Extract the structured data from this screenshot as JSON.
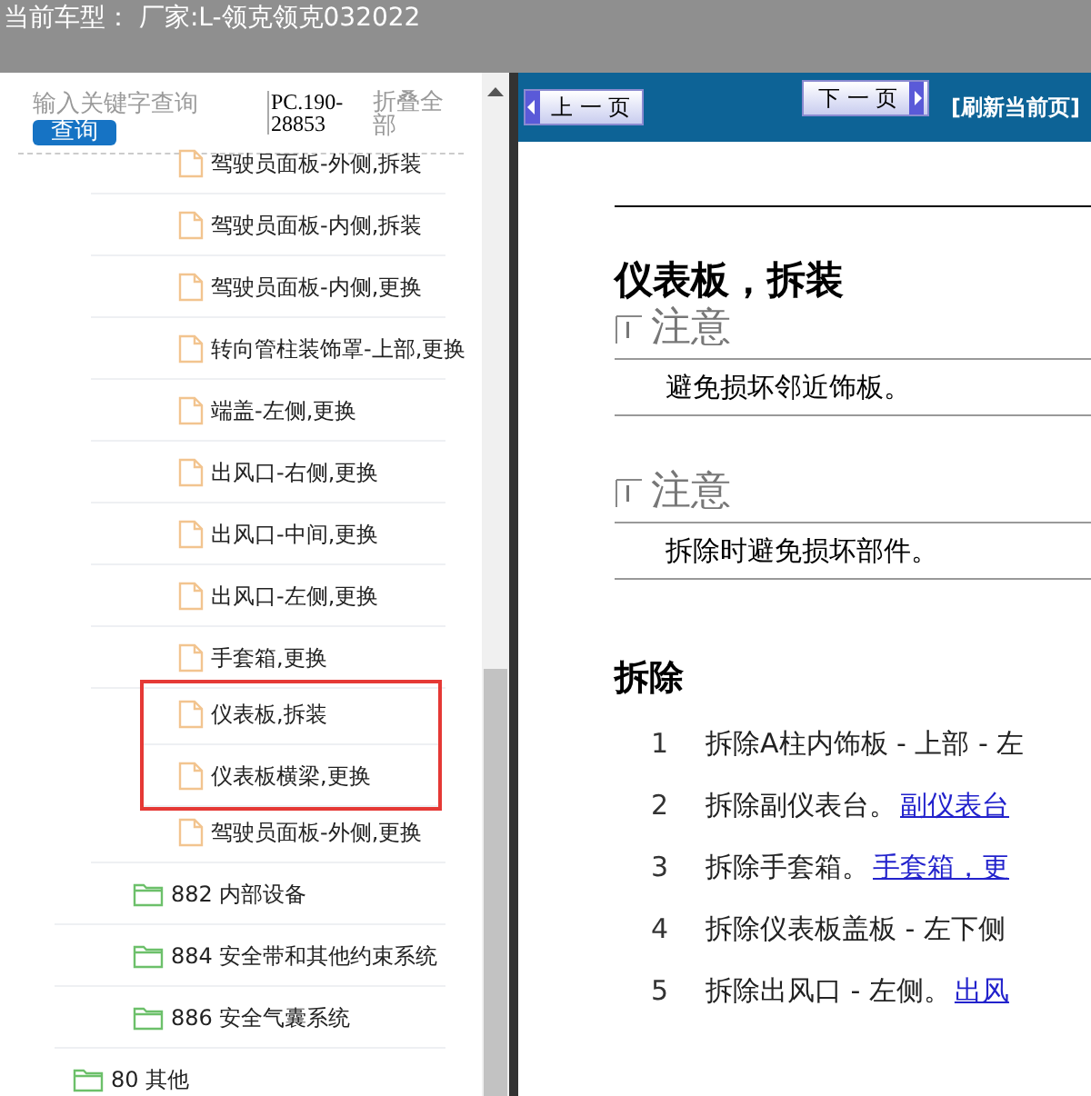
{
  "header": {
    "title": "当前车型： 厂家:L-领克领克032022"
  },
  "search": {
    "placeholder": "输入关键字查询",
    "button": "查询",
    "code": "PC.190-28853",
    "collapse_all": "折叠全部"
  },
  "tree": [
    {
      "children": [
        {
          "children": [
            {
              "kind": "file",
              "label": "驾驶员面板-外侧,拆装",
              "highlighted": false
            },
            {
              "kind": "file",
              "label": "驾驶员面板-内侧,拆装",
              "highlighted": false
            },
            {
              "kind": "file",
              "label": "驾驶员面板-内侧,更换",
              "highlighted": false
            },
            {
              "kind": "file",
              "label": "转向管柱装饰罩-上部,更换",
              "highlighted": false
            },
            {
              "kind": "file",
              "label": "端盖-左侧,更换",
              "highlighted": false
            },
            {
              "kind": "file",
              "label": "出风口-右侧,更换",
              "highlighted": false
            },
            {
              "kind": "file",
              "label": "出风口-中间,更换",
              "highlighted": false
            },
            {
              "kind": "file",
              "label": "出风口-左侧,更换",
              "highlighted": false
            },
            {
              "kind": "file",
              "label": "手套箱,更换",
              "highlighted": false
            },
            {
              "kind": "file",
              "label": "仪表板,拆装",
              "highlighted": true
            },
            {
              "kind": "file",
              "label": "仪表板横梁,更换",
              "highlighted": true
            },
            {
              "kind": "file",
              "label": "驾驶员面板-外侧,更换",
              "highlighted": false
            }
          ]
        },
        {
          "kind": "folder",
          "label": "882 内部设备",
          "highlighted": false
        },
        {
          "kind": "folder",
          "label": "884 安全带和其他约束系统",
          "highlighted": false
        },
        {
          "kind": "folder",
          "label": "886 安全气囊系统",
          "highlighted": false
        }
      ]
    },
    {
      "kind": "folder",
      "label": "80 其他",
      "highlighted": false
    }
  ],
  "toolbar": {
    "prev": "上 一 页",
    "next": "下 一 页",
    "refresh": "[刷新当前页]"
  },
  "document": {
    "title": "仪表板，拆装",
    "notes": [
      {
        "heading": "注意",
        "text": "避免损坏邻近饰板。"
      },
      {
        "heading": "注意",
        "text": "拆除时避免损坏部件。"
      }
    ],
    "section": "拆除",
    "steps": [
      {
        "number": "1",
        "text": "拆除A柱内饰板 - 上部 - 左"
      },
      {
        "number": "2",
        "text": "拆除副仪表台。",
        "link": "副仪表台"
      },
      {
        "number": "3",
        "text": "拆除手套箱。",
        "link": "手套箱，更"
      },
      {
        "number": "4",
        "text": "拆除仪表板盖板 - 左下侧"
      },
      {
        "number": "5",
        "text": "拆除出风口 - 左侧。",
        "link": "出风"
      }
    ]
  }
}
